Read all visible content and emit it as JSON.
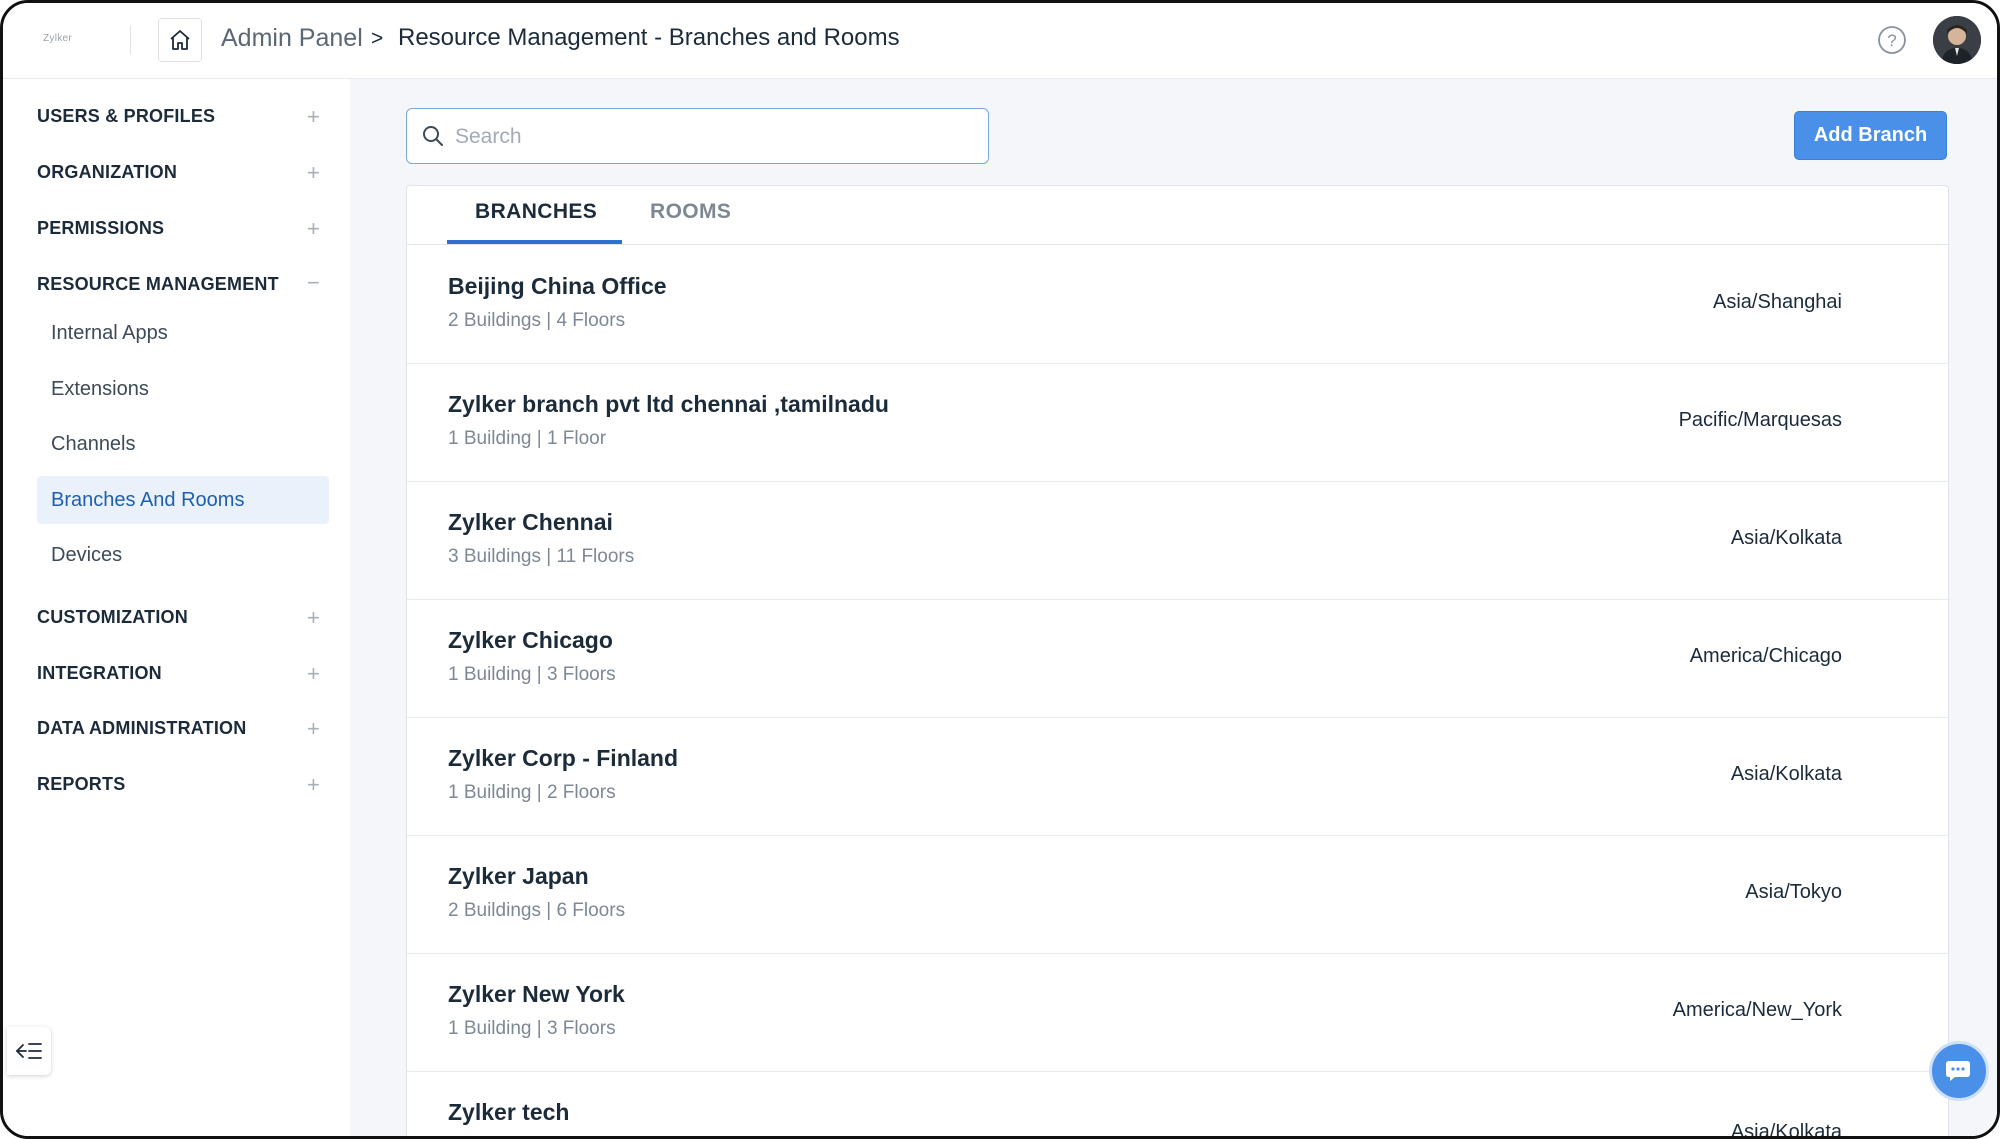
{
  "header": {
    "logo_text": "Zylker",
    "breadcrumb_root": "Admin Panel",
    "breadcrumb_separator": ">",
    "breadcrumb_page": "Resource Management - Branches and Rooms",
    "help_icon": "question-circle-icon",
    "home_icon": "home-icon"
  },
  "sidebar": {
    "sections": [
      {
        "label": "USERS & PROFILES",
        "toggle": "+"
      },
      {
        "label": "ORGANIZATION",
        "toggle": "+"
      },
      {
        "label": "PERMISSIONS",
        "toggle": "+"
      },
      {
        "label": "RESOURCE MANAGEMENT",
        "toggle": "−"
      },
      {
        "label": "CUSTOMIZATION",
        "toggle": "+"
      },
      {
        "label": "INTEGRATION",
        "toggle": "+"
      },
      {
        "label": "DATA ADMINISTRATION",
        "toggle": "+"
      },
      {
        "label": "REPORTS",
        "toggle": "+"
      }
    ],
    "resource_items": [
      {
        "label": "Internal Apps"
      },
      {
        "label": "Extensions"
      },
      {
        "label": "Channels"
      },
      {
        "label": "Branches And Rooms",
        "active": true
      },
      {
        "label": "Devices"
      }
    ],
    "collapse_icon": "collapse-sidebar-icon"
  },
  "main": {
    "search": {
      "placeholder": "Search",
      "value": ""
    },
    "add_button": "Add Branch",
    "tabs": [
      {
        "label": "BRANCHES",
        "active": true
      },
      {
        "label": "ROOMS",
        "active": false
      }
    ],
    "branches": [
      {
        "name": "Beijing China Office",
        "meta": "2 Buildings | 4 Floors",
        "timezone": "Asia/Shanghai"
      },
      {
        "name": "Zylker branch pvt ltd chennai ,tamilnadu",
        "meta": "1 Building | 1 Floor",
        "timezone": "Pacific/Marquesas"
      },
      {
        "name": "Zylker Chennai",
        "meta": "3 Buildings | 11 Floors",
        "timezone": "Asia/Kolkata"
      },
      {
        "name": "Zylker Chicago",
        "meta": "1 Building | 3 Floors",
        "timezone": "America/Chicago"
      },
      {
        "name": "Zylker Corp - Finland",
        "meta": "1 Building | 2 Floors",
        "timezone": "Asia/Kolkata"
      },
      {
        "name": "Zylker Japan",
        "meta": "2 Buildings | 6 Floors",
        "timezone": "Asia/Tokyo"
      },
      {
        "name": "Zylker New York",
        "meta": "1 Building | 3 Floors",
        "timezone": "America/New_York"
      },
      {
        "name": "Zylker tech",
        "meta": "",
        "timezone": "Asia/Kolkata"
      }
    ]
  },
  "colors": {
    "accent": "#4a90e8",
    "active_bg": "#eaf1fa",
    "active_text": "#1f5fb0",
    "tab_underline": "#2f6fd0"
  },
  "chat_icon": "chat-bubble-icon"
}
